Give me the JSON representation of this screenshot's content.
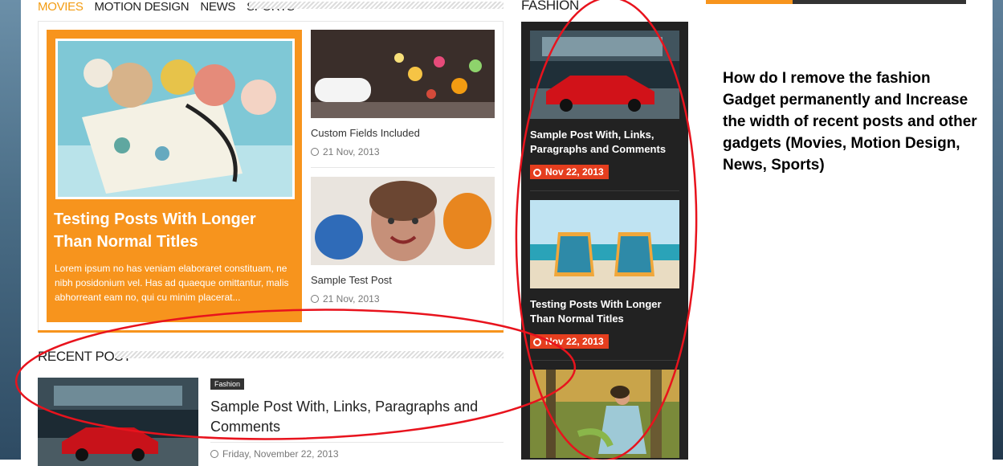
{
  "tabs": [
    {
      "label": "MOVIES",
      "active": true
    },
    {
      "label": "MOTION DESIGN",
      "active": false
    },
    {
      "label": "NEWS",
      "active": false
    },
    {
      "label": "SPORTS",
      "active": false
    }
  ],
  "featured": {
    "title": "Testing Posts With Longer Than Normal Titles",
    "excerpt": "Lorem ipsum no has veniam elaboraret constituam, ne nibh posidonium vel. Has ad quaeque omittantur, malis abhorreant eam no, qui cu minim placerat..."
  },
  "side_posts": [
    {
      "title": "Custom Fields Included",
      "date": "21 Nov, 2013"
    },
    {
      "title": "Sample Test Post",
      "date": "21 Nov, 2013"
    }
  ],
  "recent": {
    "heading": "RECENT POST",
    "category": "Fashion",
    "title": "Sample Post With, Links, Paragraphs and Comments",
    "date": "Friday, November 22, 2013"
  },
  "fashion": {
    "heading": "FASHION",
    "posts": [
      {
        "title": "Sample Post With, Links, Paragraphs and Comments",
        "date": "Nov 22, 2013"
      },
      {
        "title": "Testing Posts With Longer Than Normal Titles",
        "date": "Nov 22, 2013"
      }
    ]
  },
  "annotation": {
    "question": "How do I remove the fashion Gadget permanently and Increase the width of recent posts and other gadgets (Movies, Motion Design, News, Sports)"
  },
  "colors": {
    "accent": "#f7941d",
    "date_badge": "#e53e1e",
    "annotation": "#e8131d"
  }
}
